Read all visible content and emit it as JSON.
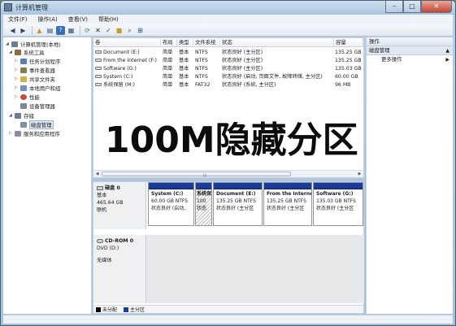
{
  "window": {
    "title": "计算机管理",
    "buttons": {
      "minimize": "–",
      "maximize": "□",
      "close": "✕"
    }
  },
  "menubar": [
    "文件(F)",
    "操作(A)",
    "查看(V)",
    "帮助(H)"
  ],
  "toolbar_icons": [
    "back-icon",
    "forward-icon",
    "up-folder-icon",
    "show-hide-tree-icon",
    "help-icon",
    "properties-icon",
    "refresh-icon",
    "delete-icon",
    "check-icon",
    "folder-icon",
    "search-icon",
    "zoom-icon"
  ],
  "tree": {
    "root": "计算机管理(本地)",
    "items": [
      {
        "label": "系统工具",
        "level": 1,
        "expander": "◢",
        "color": "#8a6d3a"
      },
      {
        "label": "任务计划程序",
        "level": 2,
        "expander": "▷",
        "color": "#5a7fb0"
      },
      {
        "label": "事件查看器",
        "level": 2,
        "expander": "▷",
        "color": "#8f7a4a"
      },
      {
        "label": "共享文件夹",
        "level": 2,
        "expander": "▷",
        "color": "#d3b04a"
      },
      {
        "label": "本地用户和组",
        "level": 2,
        "expander": "▷",
        "color": "#6b8fbf"
      },
      {
        "label": "性能",
        "level": 2,
        "expander": "▷",
        "color": "#c74a3a"
      },
      {
        "label": "设备管理器",
        "level": 2,
        "expander": "",
        "color": "#7a8a9a"
      },
      {
        "label": "存储",
        "level": 1,
        "expander": "◢",
        "color": "#6c7e91"
      },
      {
        "label": "磁盘管理",
        "level": 2,
        "expander": "",
        "color": "#7c8fa3",
        "selected": true
      },
      {
        "label": "服务和应用程序",
        "level": 1,
        "expander": "▷",
        "color": "#8b8fa2"
      }
    ]
  },
  "volume_table": {
    "headers": [
      "卷",
      "布局",
      "类型",
      "文件系统",
      "状态",
      "容量"
    ],
    "rows": [
      [
        "Document (E:)",
        "简单",
        "基本",
        "NTFS",
        "状态良好 (主分区)",
        "135.25 GB"
      ],
      [
        "From the Internet (F:)",
        "简单",
        "基本",
        "NTFS",
        "状态良好 (主分区)",
        "135.25 GB"
      ],
      [
        "Software (G:)",
        "简单",
        "基本",
        "NTFS",
        "状态良好 (主分区)",
        "135.03 GB"
      ],
      [
        "System (C:)",
        "简单",
        "基本",
        "NTFS",
        "状态良好 (启动, 页面文件, 故障转储, 主分区)",
        "60.00 GB"
      ],
      [
        "系统保留 (M:)",
        "简单",
        "基本",
        "FAT32",
        "状态良好 (系统, 主分区)",
        "96 MB"
      ]
    ]
  },
  "overlay_caption": "100M隐藏分区",
  "disks": [
    {
      "name": "磁盘 0",
      "type": "基本",
      "size": "465.64 GB",
      "status": "联机",
      "partitions": [
        {
          "name": "System (C:)",
          "size": "60.00 GB NTFS",
          "status": "状态良好 (启动,"
        },
        {
          "name": "系统保留 (M:)",
          "size": "100",
          "status": "状态",
          "hatched": true
        },
        {
          "name": "Document (E:)",
          "size": "135.25 GB NTFS",
          "status": "状态良好 (主分区"
        },
        {
          "name": "From the Interne",
          "size": "135.25 GB NTFS",
          "status": "状态良好 (主分区"
        },
        {
          "name": "Software (G:)",
          "size": "135.03 GB NTFS",
          "status": "状态良好 (主分区"
        }
      ]
    },
    {
      "name": "CD-ROM 0",
      "type": "DVD (D:)",
      "status": "无媒体"
    }
  ],
  "legend": [
    {
      "label": "未分配",
      "color": "#000000"
    },
    {
      "label": "主分区",
      "color": "#1b3b9b"
    }
  ],
  "actions": {
    "header": "操作",
    "section": "磁盘管理",
    "items": [
      "更多操作"
    ]
  }
}
